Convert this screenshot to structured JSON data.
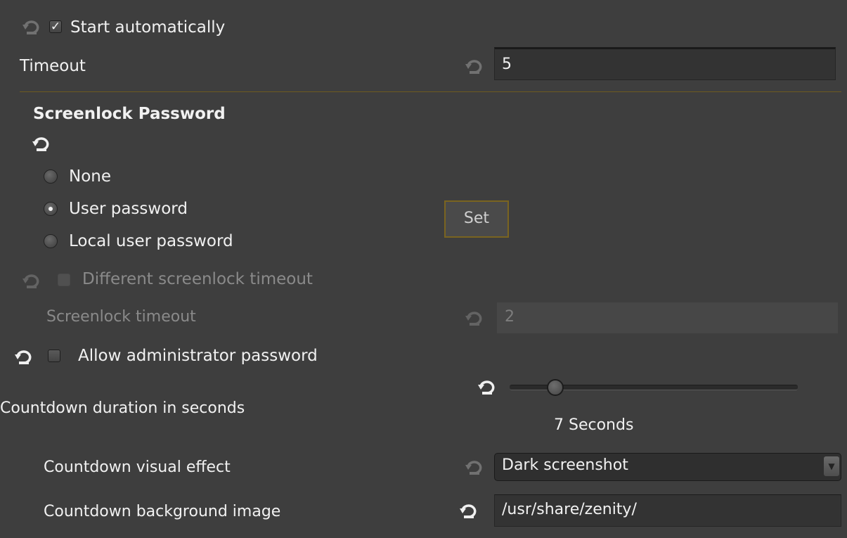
{
  "start_automatically": {
    "label": "Start automatically",
    "checked": true
  },
  "timeout": {
    "label": "Timeout",
    "value": "5"
  },
  "screenlock_password": {
    "heading": "Screenlock Password",
    "options": [
      {
        "label": "None",
        "selected": false
      },
      {
        "label": "User password",
        "selected": true
      },
      {
        "label": "Local user password",
        "selected": false
      }
    ],
    "set_label": "Set"
  },
  "different_timeout": {
    "label": "Different screenlock timeout",
    "checked": false
  },
  "screenlock_timeout": {
    "label": "Screenlock timeout",
    "value": "2"
  },
  "allow_admin": {
    "label": "Allow administrator password",
    "checked": false
  },
  "countdown": {
    "label": "Countdown duration in seconds",
    "value_text": "7 Seconds",
    "slider_fraction": 0.13
  },
  "visual_effect": {
    "label": "Countdown visual effect",
    "selected": "Dark screenshot"
  },
  "background_image": {
    "label": "Countdown background image",
    "value": "/usr/share/zenity/"
  },
  "icons": {
    "reset": "reset-icon",
    "dropdown": "chevron-down-icon",
    "check": "checkmark-icon"
  },
  "colors": {
    "background": "#3e3e3e",
    "accent": "#7a6420",
    "text": "#f1f1f1",
    "disabled_text": "#8a8a8a"
  }
}
